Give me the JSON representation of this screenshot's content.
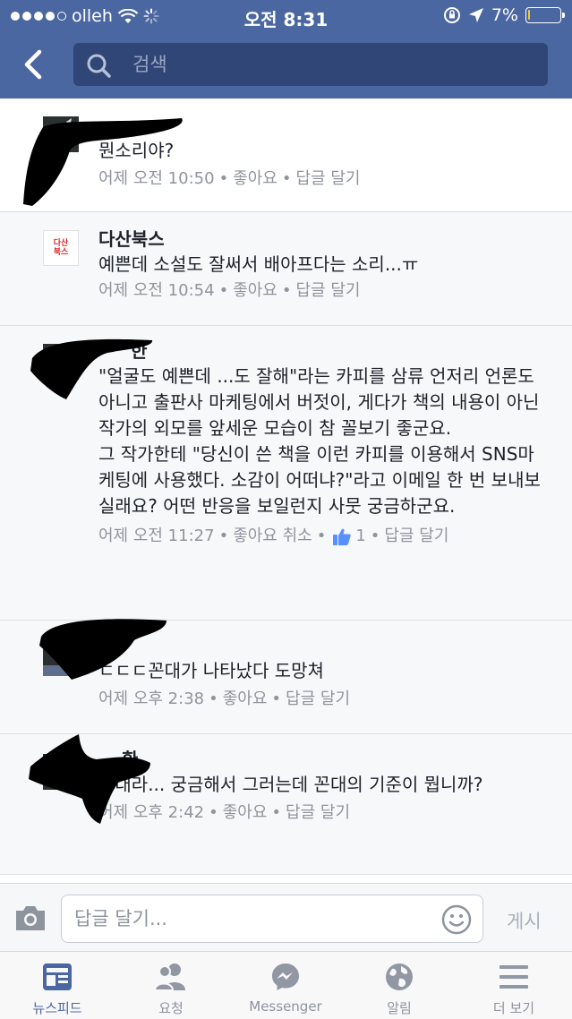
{
  "status_bar": {
    "carrier": "olleh",
    "time": "오전 8:31",
    "battery": "7%",
    "battery_level": 0.07,
    "battery_color": "#f2c833"
  },
  "header": {
    "back_icon": "chevron-left-icon",
    "search_placeholder": "검색",
    "color": "#4b67a1"
  },
  "comments": [
    {
      "name": "",
      "text": "뭔소리야?",
      "time": "어제 오전 10:50",
      "like": "좋아요",
      "reply": "답글 달기"
    },
    {
      "name": "다산북스",
      "avatar_text": "다산\n북스",
      "text": "예쁜데 소설도 잘써서 배아프다는 소리...ㅠ",
      "time": "어제 오전 10:54",
      "like": "좋아요",
      "reply": "답글 달기"
    },
    {
      "name": "한",
      "text": "\"얼굴도 예쁜데 ...도 잘해\"라는 카피를 삼류 언저리 언론도 아니고 출판사 마케팅에서 버젓이, 게다가 책의 내용이 아닌 작가의 외모를 앞세운 모습이 참 꼴보기 좋군요.\n그 작가한테 \"당신이 쓴 책을 이런 카피를 이용해서 SNS마케팅에 사용했다. 소감이 어떠냐?\"라고 이메일 한 번 보내보실래요? 어떤 반응을 보일런지 사뭇 궁금하군요.",
      "time": "어제 오전 11:27",
      "like": "좋아요 취소",
      "like_count": "1",
      "reply": "답글 달기"
    },
    {
      "name": "",
      "text": "ㄷㄷㄷ꼰대가 나타났다 도망쳐",
      "time": "어제 오후 2:38",
      "like": "좋아요",
      "reply": "답글 달기"
    },
    {
      "name": "환",
      "text": "꼰대라... 궁금해서 그러는데 꼰대의 기준이 뭡니까?",
      "time": "어제 오후 2:42",
      "like": "좋아요",
      "reply": "답글 달기"
    }
  ],
  "reply_bar": {
    "placeholder": "답글 달기...",
    "post_label": "게시"
  },
  "tabs": [
    {
      "label": "뉴스피드",
      "icon": "newsfeed-icon",
      "active": true
    },
    {
      "label": "요청",
      "icon": "friend-requests-icon",
      "active": false
    },
    {
      "label": "Messenger",
      "icon": "messenger-icon",
      "active": false
    },
    {
      "label": "알림",
      "icon": "globe-icon",
      "active": false
    },
    {
      "label": "더 보기",
      "icon": "menu-icon",
      "active": false
    }
  ]
}
